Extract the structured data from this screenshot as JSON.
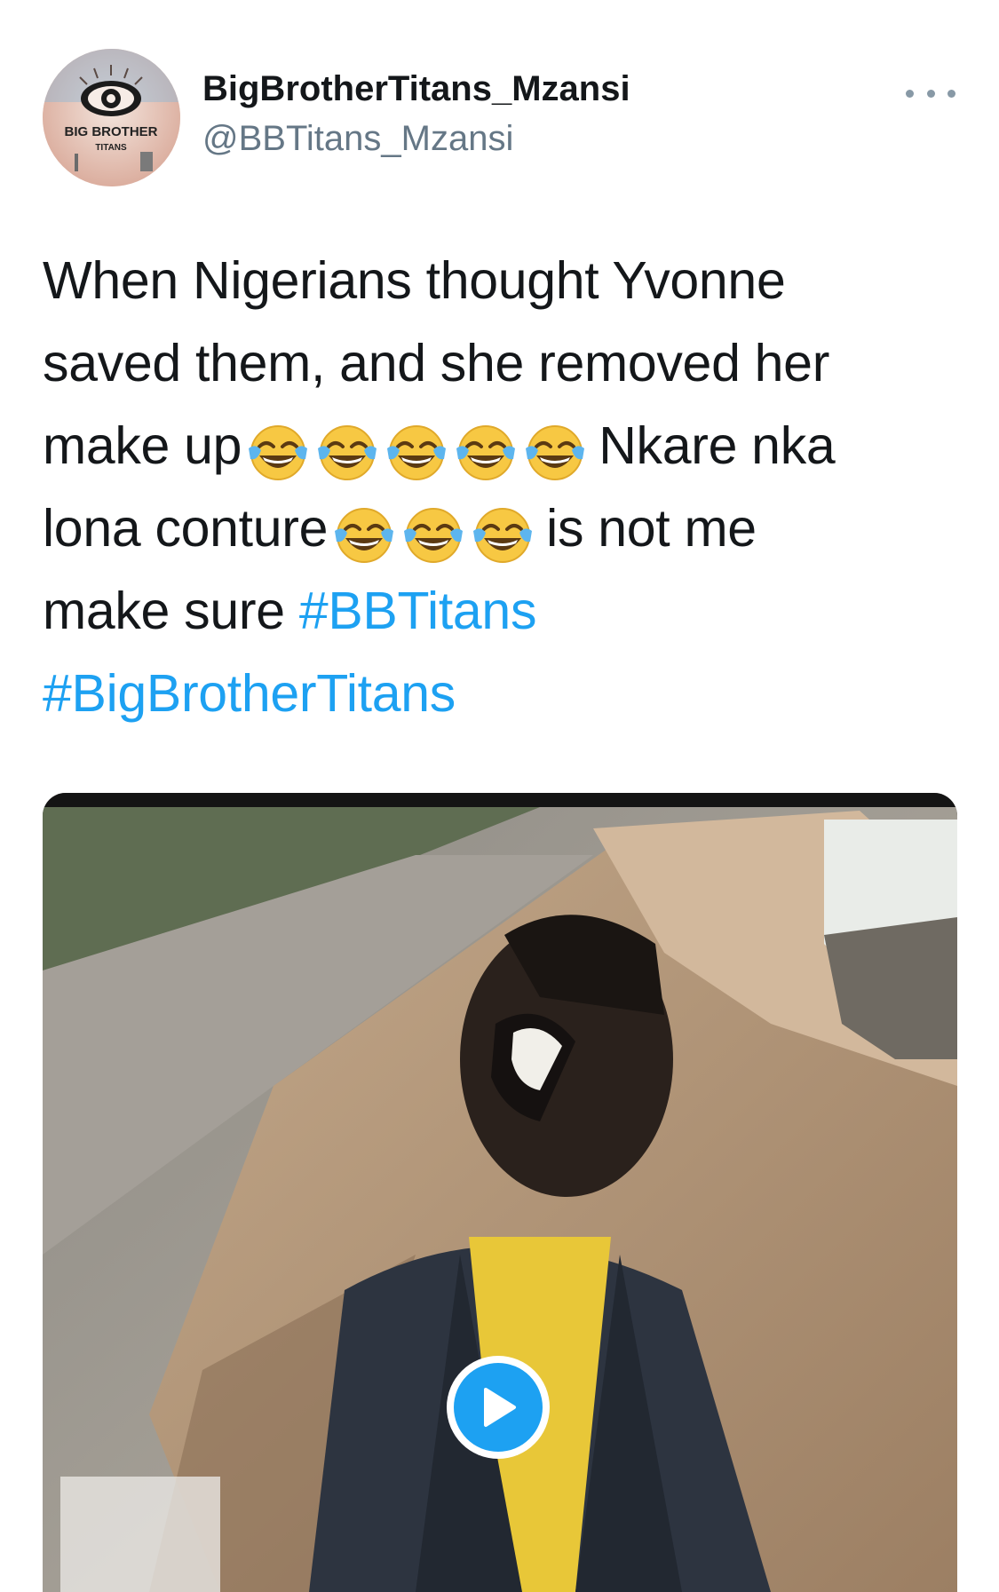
{
  "author": {
    "name": "BigBrotherTitans_Mzansi",
    "handle": "@BBTitans_Mzansi",
    "avatar_logo_text": "BIG BROTHER",
    "avatar_logo_subtext": "TITANS"
  },
  "tweet": {
    "line1": "When Nigerians thought Yvonne",
    "line2": "saved them, and she removed her",
    "line3_prefix": "make up",
    "line3_suffix": "Nkare nka",
    "line4_prefix": "lona conture",
    "line4_suffix": "is not me",
    "line5_prefix": "make sure",
    "hashtag1": "#BBTitans",
    "hashtag2": "#BigBrotherTitans",
    "emoji_name": "face-with-tears-of-joy",
    "emoji_count_line3": 5,
    "emoji_count_line4": 3
  },
  "media": {
    "type": "video",
    "icon": "play-icon"
  },
  "colors": {
    "hashtag": "#1da1f2",
    "secondary_text": "#657786",
    "play_button": "#1da1f2"
  }
}
